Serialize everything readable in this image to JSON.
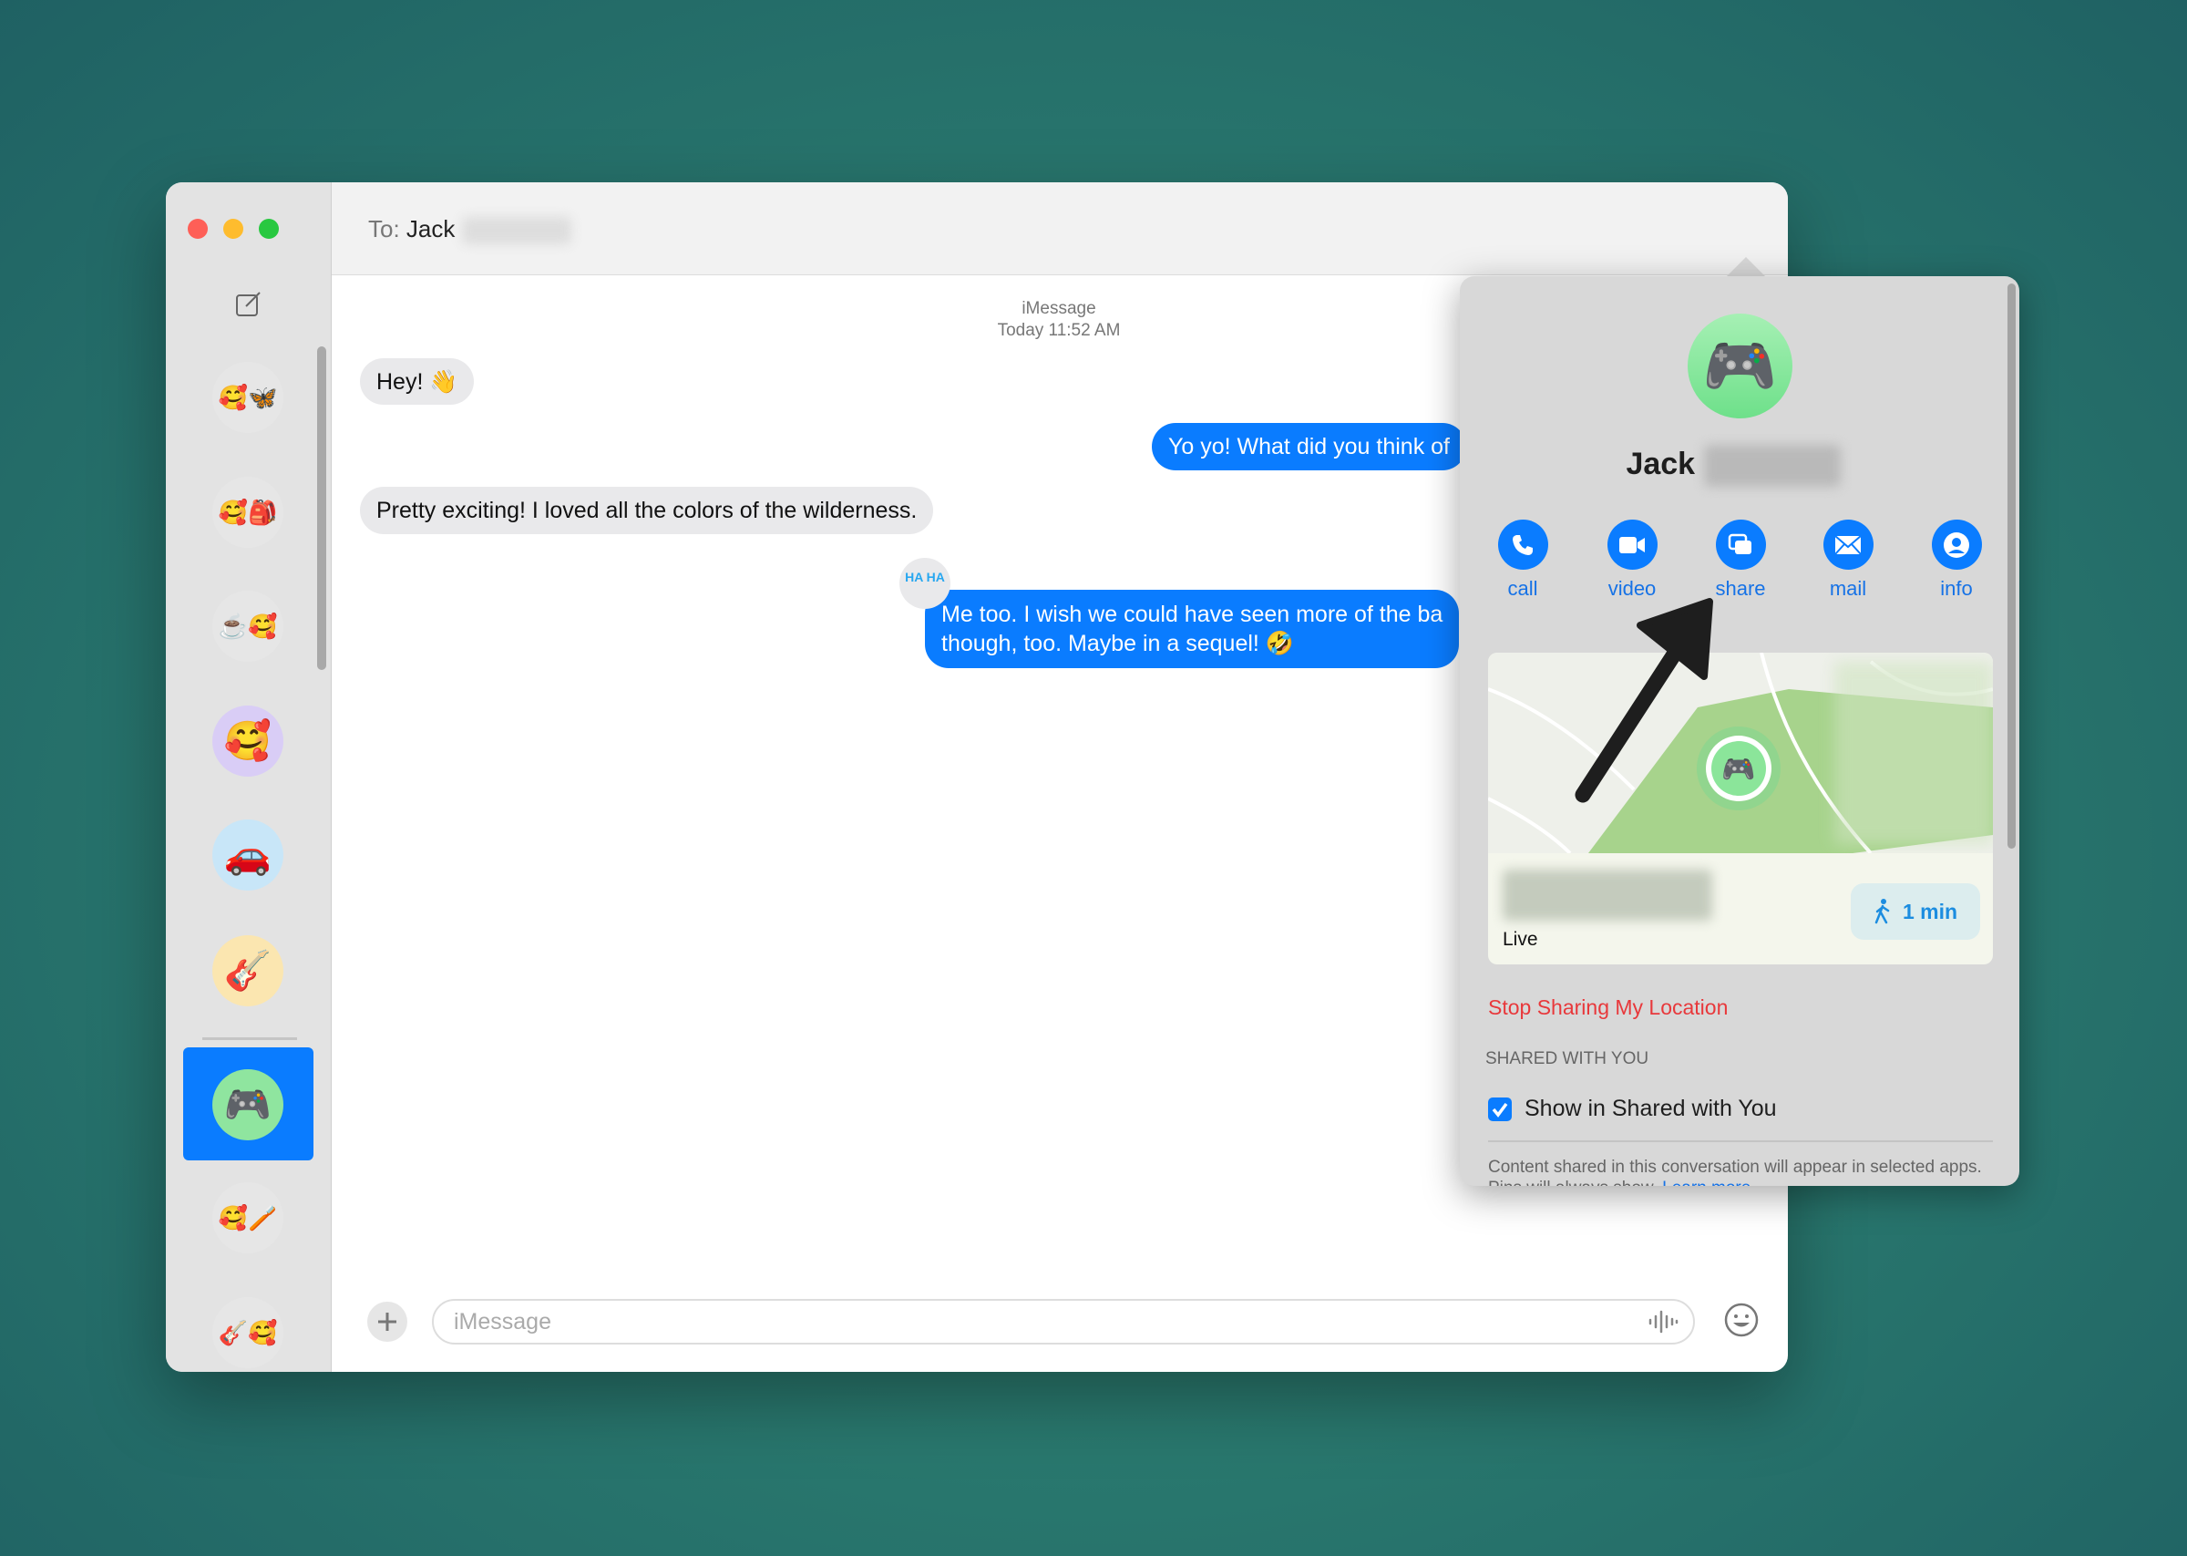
{
  "window": {
    "to_label": "To:",
    "recipient_first": "Jack"
  },
  "conversation": {
    "service": "iMessage",
    "timestamp": "Today 11:52 AM",
    "messages": [
      {
        "dir": "in",
        "text": "Hey! 👋"
      },
      {
        "dir": "out",
        "text": "Yo yo! What did you think of"
      },
      {
        "dir": "in",
        "text": "Pretty exciting! I loved all the colors of the wilderness."
      },
      {
        "dir": "out",
        "line1": "Me too. I wish we could have seen more of the ba",
        "line2": "though, too. Maybe in a sequel! 🤣",
        "tapback": "HA HA"
      }
    ]
  },
  "sidebar": {
    "avatars": [
      "🥰🦋",
      "🥰🎒",
      "☕🥰",
      "🥰",
      "🚗",
      "🎸",
      "🎮",
      "🥰🪥",
      "🎸🥰"
    ],
    "selected_index": 6
  },
  "input": {
    "placeholder": "iMessage"
  },
  "details": {
    "name": "Jack",
    "avatar": "🎮",
    "actions": [
      {
        "label": "call",
        "icon": "phone-icon"
      },
      {
        "label": "video",
        "icon": "video-icon"
      },
      {
        "label": "share",
        "icon": "share-screen-icon"
      },
      {
        "label": "mail",
        "icon": "mail-icon"
      },
      {
        "label": "info",
        "icon": "person-icon"
      }
    ],
    "map": {
      "status": "Live",
      "eta": "1 min"
    },
    "stop_sharing": "Stop Sharing My Location",
    "shared_section": "SHARED WITH YOU",
    "show_in_shared": {
      "label": "Show in Shared with You",
      "checked": true
    },
    "footnote": "Content shared in this conversation will appear in selected apps. Pins will always show.",
    "learn_more": "Learn more"
  },
  "colors": {
    "accent": "#0a7cff",
    "destructive": "#e8383b"
  }
}
